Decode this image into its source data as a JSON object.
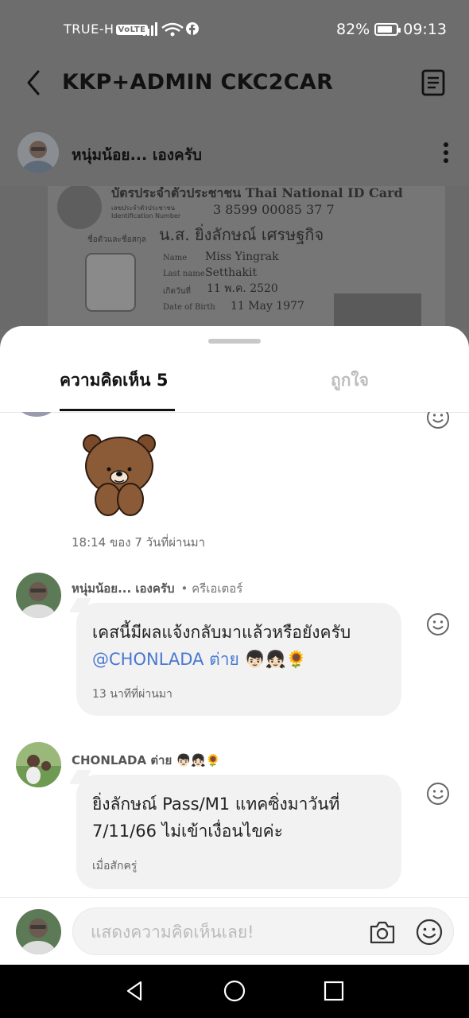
{
  "status": {
    "carrier": "TRUE-H",
    "volte": "VoLTE",
    "battery": "82%",
    "battery_level": 0.82,
    "time": "09:13"
  },
  "appbar": {
    "title": "KKP+ADMIN CKC2CAR"
  },
  "post": {
    "author": "หนุ่มน้อย... เองครับ"
  },
  "idcard": {
    "heading": "บัตรประจำตัวประชาชน Thai National ID Card",
    "id_label": "เลขประจำตัวประชาชน",
    "id_label_en": "Identification Number",
    "id_number": "3 8599 00085 37 7",
    "name_label": "ชื่อตัวและชื่อสกุล",
    "name_th": "น.ส. ยิ่งลักษณ์ เศรษฐกิจ",
    "name_en_label": "Name",
    "name_en": "Miss Yingrak",
    "last_label": "Last name",
    "last_en": "Setthakit",
    "dob_th_label": "เกิดวันที่",
    "dob_th": "11 พ.ค. 2520",
    "dob_en_label": "Date of Birth",
    "dob_en": "11 May 1977"
  },
  "sheet": {
    "tab_comments": "ความคิดเห็น 5",
    "tab_likes": "ถูกใจ"
  },
  "comments": [
    {
      "time": "18:14 ของ 7 วันที่ผ่านมา"
    },
    {
      "name": "หนุ่มน้อย... เองครับ",
      "role": "• ครีเอเตอร์",
      "text": "เคสนี้มีผลแจ้งกลับมาแล้วหรือยังครับ",
      "mention": "@CHONLADA ต่าย 👦🏻👧🏻🌻",
      "time": "13 นาทีที่ผ่านมา"
    },
    {
      "name": "CHONLADA ต่าย 👦🏻👧🏻🌻",
      "text": "ยิ่งลักษณ์ Pass/M1 แทคซิ่งมาวันที่ 7/11/66 ไม่เข้าเงื่อนไขค่ะ",
      "time": "เมื่อสักครู่"
    }
  ],
  "composer": {
    "placeholder": "แสดงความคิดเห็นเลย!"
  }
}
